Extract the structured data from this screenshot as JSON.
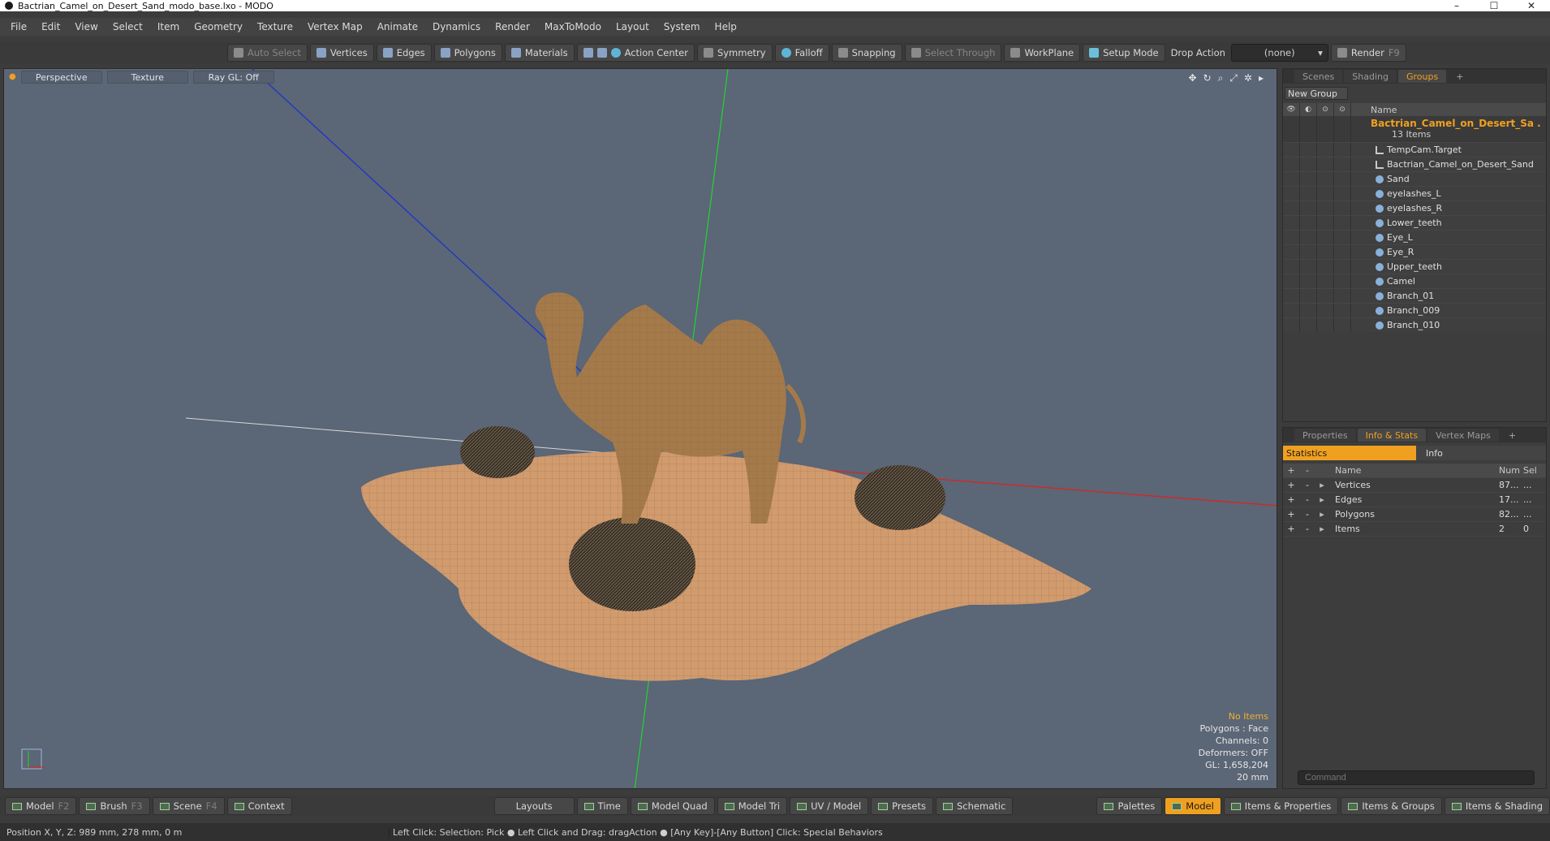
{
  "window": {
    "title": "Bactrian_Camel_on_Desert_Sand_modo_base.lxo - MODO",
    "min": "–",
    "max": "☐",
    "close": "✕"
  },
  "menu": [
    "File",
    "Edit",
    "View",
    "Select",
    "Item",
    "Geometry",
    "Texture",
    "Vertex Map",
    "Animate",
    "Dynamics",
    "Render",
    "MaxToModo",
    "Layout",
    "System",
    "Help"
  ],
  "toolbar": {
    "auto_select": "Auto Select",
    "vertices": "Vertices",
    "edges": "Edges",
    "polygons": "Polygons",
    "materials": "Materials",
    "action_center": "Action Center",
    "symmetry": "Symmetry",
    "falloff": "Falloff",
    "snapping": "Snapping",
    "select_through": "Select Through",
    "workplane": "WorkPlane",
    "setup_mode": "Setup Mode",
    "drop_action_label": "Drop Action",
    "drop_action_value": "(none)",
    "render": "Render",
    "render_key": "F9"
  },
  "viewport": {
    "tabs": [
      "Perspective",
      "Texture",
      "Ray GL: Off"
    ],
    "nav_icons": [
      "move-icon",
      "rotate-icon",
      "zoom-icon",
      "fit-icon",
      "settings-icon",
      "play-icon"
    ],
    "stats": {
      "no_items": "No Items",
      "polygons": "Polygons : Face",
      "channels": "Channels: 0",
      "deformers": "Deformers: OFF",
      "gl": "GL: 1,658,204",
      "scale": "20 mm"
    }
  },
  "groups_panel": {
    "tabs": [
      "Scenes",
      "Shading",
      "Groups",
      "+"
    ],
    "active_tab": "Groups",
    "new_group": "New Group",
    "header_name": "Name",
    "group_title": "Bactrian_Camel_on_Desert_Sa ...",
    "group_count": "13 Items",
    "items": [
      {
        "name": "TempCam.Target",
        "icon": "locator-icon"
      },
      {
        "name": "Bactrian_Camel_on_Desert_Sand",
        "icon": "locator-icon"
      },
      {
        "name": "Sand",
        "icon": "mesh-icon"
      },
      {
        "name": "eyelashes_L",
        "icon": "mesh-icon"
      },
      {
        "name": "eyelashes_R",
        "icon": "mesh-icon"
      },
      {
        "name": "Lower_teeth",
        "icon": "mesh-icon"
      },
      {
        "name": "Eye_L",
        "icon": "mesh-icon"
      },
      {
        "name": "Eye_R",
        "icon": "mesh-icon"
      },
      {
        "name": "Upper_teeth",
        "icon": "mesh-icon"
      },
      {
        "name": "Camel",
        "icon": "mesh-icon"
      },
      {
        "name": "Branch_01",
        "icon": "mesh-icon"
      },
      {
        "name": "Branch_009",
        "icon": "mesh-icon"
      },
      {
        "name": "Branch_010",
        "icon": "mesh-icon"
      }
    ]
  },
  "info_panel": {
    "tabs": [
      "Properties",
      "Info & Stats",
      "Vertex Maps",
      "+"
    ],
    "active_tab": "Info & Stats",
    "statistics": "Statistics",
    "info": "Info",
    "columns": {
      "name": "Name",
      "num": "Num",
      "sel": "Sel"
    },
    "rows": [
      {
        "name": "Vertices",
        "num": "87...",
        "sel": "..."
      },
      {
        "name": "Edges",
        "num": "17...",
        "sel": "..."
      },
      {
        "name": "Polygons",
        "num": "82...",
        "sel": "..."
      },
      {
        "name": "Items",
        "num": "2",
        "sel": "0"
      }
    ],
    "command_placeholder": "Command"
  },
  "bottombar": {
    "left": [
      {
        "label": "Model",
        "key": "F2"
      },
      {
        "label": "Brush",
        "key": "F3"
      },
      {
        "label": "Scene",
        "key": "F4"
      },
      {
        "label": "Context",
        "key": ""
      }
    ],
    "center": [
      "Layouts",
      "Time",
      "Model Quad",
      "Model Tri",
      "UV / Model",
      "Presets",
      "Schematic"
    ],
    "right": [
      "Palettes",
      "Model",
      "Items & Properties",
      "Items & Groups",
      "Items & Shading"
    ],
    "active": "Model"
  },
  "statusbar": {
    "position": "Position X, Y, Z:   989 mm, 278 mm, 0 m",
    "hint": "Left Click: Selection: Pick ● Left Click and Drag: dragAction ● [Any Key]-[Any Button] Click: Special Behaviors"
  },
  "colors": {
    "accent": "#f0a020",
    "viewport_bg": "#5b6676"
  }
}
